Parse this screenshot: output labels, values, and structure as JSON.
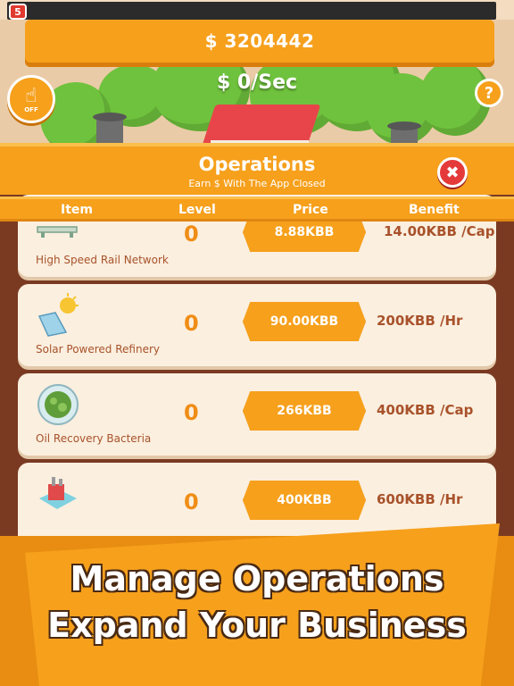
{
  "hud": {
    "level_badge": "5",
    "money": "$ 3204442",
    "rate": "$ 0/Sec",
    "auto_tap_label": "OFF",
    "help_label": "?"
  },
  "operations_panel": {
    "title": "Operations",
    "subtitle": "Earn $ With The App Closed",
    "close_label": "✖",
    "columns": [
      "Item",
      "Level",
      "Price",
      "Benefit"
    ],
    "rows": [
      {
        "name": "High Speed Rail Network",
        "level": "0",
        "price": "8.88KBB",
        "benefit": "14.00KBB /Cap"
      },
      {
        "name": "Solar Powered Refinery",
        "level": "0",
        "price": "90.00KBB",
        "benefit": "200KBB /Hr"
      },
      {
        "name": "Oil Recovery Bacteria",
        "level": "0",
        "price": "266KBB",
        "benefit": "400KBB /Cap"
      },
      {
        "name": "",
        "level": "0",
        "price": "400KBB",
        "benefit": "600KBB /Hr"
      }
    ]
  },
  "promo": {
    "line1": "Manage Operations",
    "line2": "Expand Your Business"
  },
  "colors": {
    "accent_orange": "#f6a01c",
    "panel_brown": "#7a3a22",
    "card_cream": "#fbefdf",
    "close_red": "#e53a3a",
    "text_brown": "#a8522b"
  }
}
